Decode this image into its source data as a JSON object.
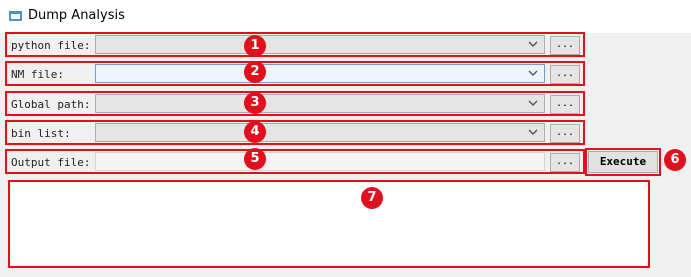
{
  "window": {
    "title": "Dump Analysis",
    "icon": "app-window-icon"
  },
  "rows": [
    {
      "label": "python file:",
      "value": "",
      "browse_label": "...",
      "badge": "1"
    },
    {
      "label": "NM file:",
      "value": "",
      "browse_label": "...",
      "badge": "2"
    },
    {
      "label": "Global path:",
      "value": "",
      "browse_label": "...",
      "badge": "3"
    },
    {
      "label": "bin list:",
      "value": "",
      "browse_label": "...",
      "badge": "4"
    },
    {
      "label": "Output file:",
      "value": "",
      "browse_label": "...",
      "badge": "5"
    }
  ],
  "execute": {
    "label": "Execute",
    "badge": "6"
  },
  "log": {
    "text": "",
    "badge": "7"
  },
  "colors": {
    "annotation": "#e0101e",
    "field_bg": "#e5e5e5",
    "active_field_bg": "#eef4fc"
  }
}
